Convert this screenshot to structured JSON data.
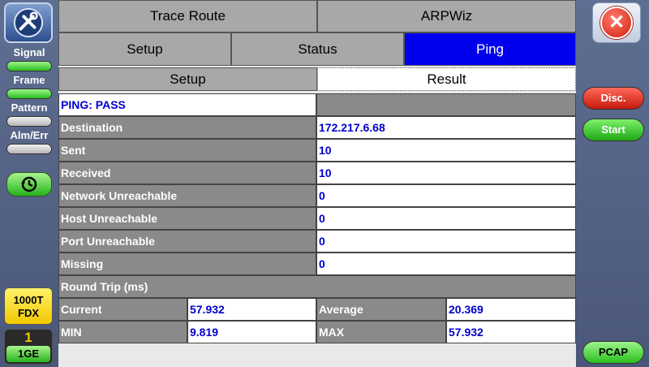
{
  "left_sidebar": {
    "signal_label": "Signal",
    "frame_label": "Frame",
    "pattern_label": "Pattern",
    "alm_err_label": "Alm/Err",
    "speed_line1": "1000T",
    "speed_line2": "FDX",
    "port_number": "1",
    "port_speed": "1GE"
  },
  "right_sidebar": {
    "disc_label": "Disc.",
    "start_label": "Start",
    "pcap_label": "PCAP"
  },
  "tabs": {
    "row1": [
      "Trace Route",
      "ARPWiz"
    ],
    "row2": [
      "Setup",
      "Status",
      "Ping"
    ],
    "row3": [
      "Setup",
      "Result"
    ]
  },
  "result": {
    "status": "PING: PASS",
    "rows": [
      {
        "label": "Destination",
        "value": "172.217.6.68"
      },
      {
        "label": "Sent",
        "value": "10"
      },
      {
        "label": "Received",
        "value": "10"
      },
      {
        "label": "Network Unreachable",
        "value": "0"
      },
      {
        "label": "Host Unreachable",
        "value": "0"
      },
      {
        "label": "Port Unreachable",
        "value": "0"
      },
      {
        "label": "Missing",
        "value": "0"
      }
    ],
    "round_trip_header": "Round Trip (ms)",
    "current_label": "Current",
    "current_value": "57.932",
    "average_label": "Average",
    "average_value": "20.369",
    "min_label": "MIN",
    "min_value": "9.819",
    "max_label": "MAX",
    "max_value": "57.932"
  },
  "colors": {
    "active_tab": "#0000ee",
    "value_text": "#0000cc",
    "label_bg": "#8a8a8a"
  }
}
